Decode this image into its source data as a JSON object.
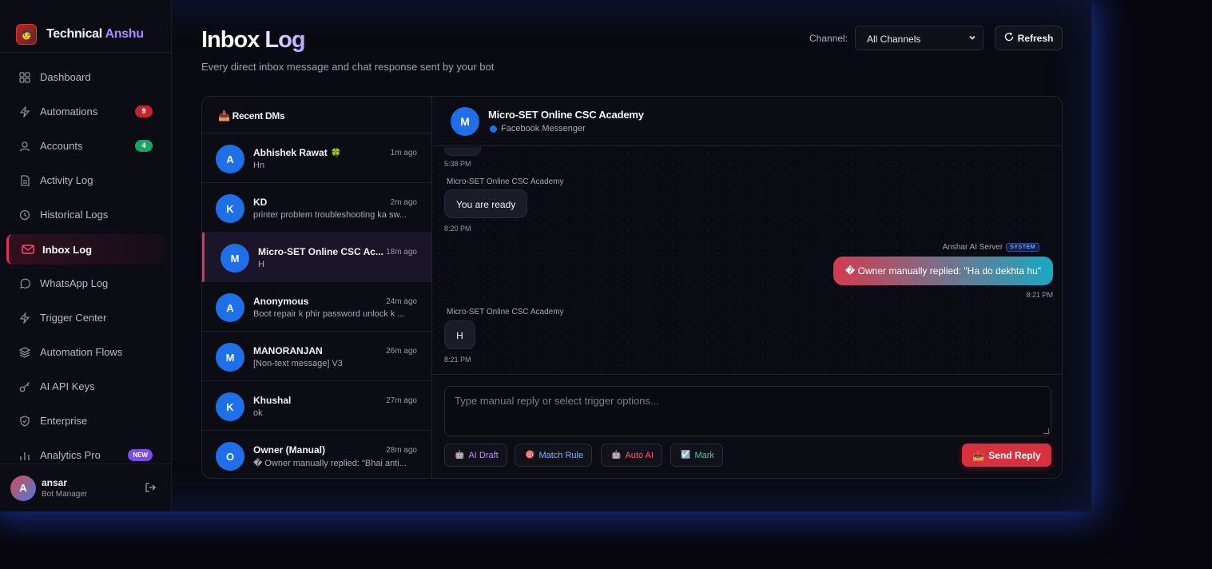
{
  "brand": {
    "name_part1": "Technical",
    "name_part2": "Anshu",
    "logo_icon": "app-logo"
  },
  "sidebar": {
    "items": [
      {
        "label": "Dashboard",
        "icon": "grid-icon"
      },
      {
        "label": "Automations",
        "icon": "bolt-icon",
        "badge": "9"
      },
      {
        "label": "Accounts",
        "icon": "user-icon",
        "badge": "4"
      },
      {
        "label": "Activity Log",
        "icon": "document-icon"
      },
      {
        "label": "Historical Logs",
        "icon": "clock-icon"
      },
      {
        "label": "Inbox Log",
        "icon": "mail-icon",
        "active": true
      },
      {
        "label": "WhatsApp Log",
        "icon": "chat-icon"
      },
      {
        "label": "Trigger Center",
        "icon": "bolt-icon"
      },
      {
        "label": "Automation Flows",
        "icon": "layers-icon"
      },
      {
        "label": "AI API Keys",
        "icon": "key-icon"
      },
      {
        "label": "Enterprise",
        "icon": "shield-icon"
      },
      {
        "label": "Analytics Pro",
        "icon": "bar-chart-icon",
        "badge": "NEW"
      }
    ],
    "user": {
      "initial": "A",
      "name": "ansar",
      "role": "Bot Manager"
    }
  },
  "header": {
    "title": "Inbox Log",
    "subtitle": "Every direct inbox message and chat response sent by your bot",
    "channel_label": "Channel:",
    "channel_value": "All Channels",
    "refresh_label": "Refresh"
  },
  "dm_list": {
    "title": "📥 Recent DMs",
    "items": [
      {
        "initial": "A",
        "name": "Abhishek Rawat",
        "emoji": "🍀",
        "time": "1m ago",
        "preview": "Hn"
      },
      {
        "initial": "K",
        "name": "KD",
        "time": "2m ago",
        "preview": "printer problem troubleshooting ka sw..."
      },
      {
        "initial": "M",
        "name": "Micro-SET Online CSC Ac...",
        "time": "18m ago",
        "preview": "H",
        "active": true
      },
      {
        "initial": "A",
        "name": "Anonymous",
        "time": "24m ago",
        "preview": "Boot repair k phir password unlock k ..."
      },
      {
        "initial": "M",
        "name": "MANORANJAN",
        "time": "26m ago",
        "preview": "[Non-text message] V3"
      },
      {
        "initial": "K",
        "name": "Khushal",
        "time": "27m ago",
        "preview": "ok"
      },
      {
        "initial": "O",
        "name": "Owner (Manual)",
        "time": "28m ago",
        "preview": "� Owner manually replied: \"Bhai anti..."
      }
    ]
  },
  "chat": {
    "initial": "M",
    "name": "Micro-SET Online CSC Academy",
    "platform": "Facebook Messenger",
    "messages": [
      {
        "time": "5:38 PM"
      },
      {
        "sender": "Micro-SET Online CSC Academy",
        "text": "You are ready",
        "time": "8:20 PM"
      },
      {
        "sender": "Anshar AI Server",
        "badge": "SYSTEM",
        "text": "� Owner manually replied: \"Ha do dekhta hu\"",
        "time": "8:21 PM"
      },
      {
        "sender": "Micro-SET Online CSC Academy",
        "text": "H",
        "time": "8:21 PM"
      }
    ],
    "composer": {
      "placeholder": "Type manual reply or select trigger options...",
      "chips": [
        {
          "label": "AI Draft",
          "icon": "robot-icon",
          "color": "#b98cff"
        },
        {
          "label": "Match Rule",
          "icon": "target-icon",
          "color": "#7db3ff"
        },
        {
          "label": "Auto AI",
          "icon": "robot-icon",
          "color": "#ff5a64"
        },
        {
          "label": "Mark",
          "icon": "checkbox-icon",
          "color": "#3fd28a"
        }
      ],
      "send_label": "Send Reply"
    }
  }
}
